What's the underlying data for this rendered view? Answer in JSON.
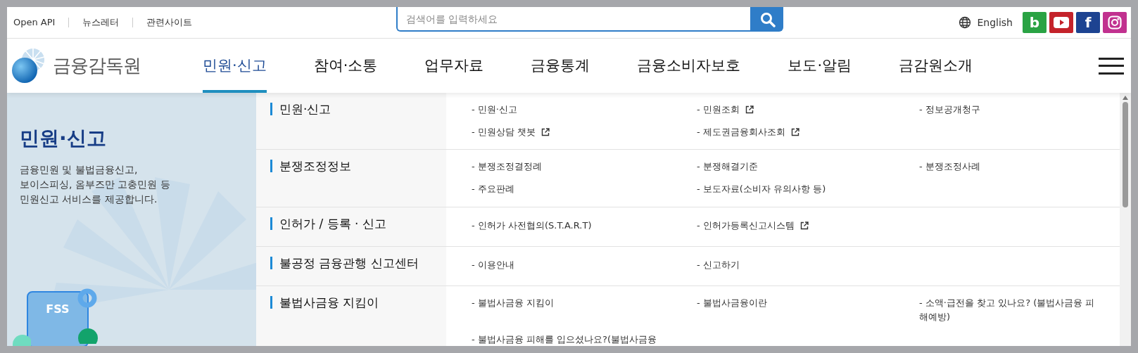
{
  "top_links": [
    "Open API",
    "뉴스레터",
    "관련사이트"
  ],
  "search": {
    "placeholder": "검색어를 입력하세요"
  },
  "language": "English",
  "social": [
    {
      "kind": "blog",
      "glyph": "b",
      "color": "#2aa344"
    },
    {
      "kind": "youtube",
      "color": "#c4232b"
    },
    {
      "kind": "facebook",
      "glyph": "f",
      "color": "#1d4391"
    },
    {
      "kind": "instagram",
      "color": "#c1318f"
    }
  ],
  "logo": {
    "text": "금융감독원"
  },
  "nav": [
    {
      "label": "민원·신고",
      "selected": true
    },
    {
      "label": "참여·소통",
      "selected": false
    },
    {
      "label": "업무자료",
      "selected": false
    },
    {
      "label": "금융통계",
      "selected": false
    },
    {
      "label": "금융소비자보호",
      "selected": false
    },
    {
      "label": "보도·알림",
      "selected": false
    },
    {
      "label": "금감원소개",
      "selected": false
    }
  ],
  "panel": {
    "title": "민원·신고",
    "description": "금융민원 및 불법금융신고,\n보이스피싱, 옴부즈만 고충민원 등\n민원신고 서비스를 제공합니다.",
    "illustration_label": "FSS"
  },
  "sections": [
    {
      "title": "민원·신고",
      "links": [
        {
          "text": "- 민원·신고",
          "external": false
        },
        {
          "text": "- 민원조회",
          "external": true
        },
        {
          "text": "- 정보공개청구",
          "external": false
        },
        {
          "text": "- 민원상담 챗봇",
          "external": true
        },
        {
          "text": "- 제도권금융회사조회",
          "external": true
        }
      ]
    },
    {
      "title": "분쟁조정정보",
      "links": [
        {
          "text": "- 분쟁조정결정례",
          "external": false
        },
        {
          "text": "- 분쟁해결기준",
          "external": false
        },
        {
          "text": "- 분쟁조정사례",
          "external": false
        },
        {
          "text": "- 주요판례",
          "external": false
        },
        {
          "text": "- 보도자료(소비자 유의사항 등)",
          "external": false
        }
      ]
    },
    {
      "title": "인허가 / 등록 · 신고",
      "links": [
        {
          "text": "- 인허가 사전협의(S.T.A.R.T)",
          "external": false
        },
        {
          "text": "- 인허가등록신고시스템",
          "external": true
        }
      ]
    },
    {
      "title": "불공정 금융관행 신고센터",
      "links": [
        {
          "text": "- 이용안내",
          "external": false
        },
        {
          "text": "- 신고하기",
          "external": false
        }
      ]
    },
    {
      "title": "불법사금융 지킴이",
      "links": [
        {
          "text": "- 불법사금융 지킴이",
          "external": false
        },
        {
          "text": "- 불법사금융이란",
          "external": false
        },
        {
          "text": "- 소액·급전을 찾고 있나요? (불법사금융 피해예방)",
          "external": false
        },
        {
          "text": "- 불법사금융 피해를 입으셨나요?(불법사금융",
          "external": false
        }
      ]
    }
  ]
}
